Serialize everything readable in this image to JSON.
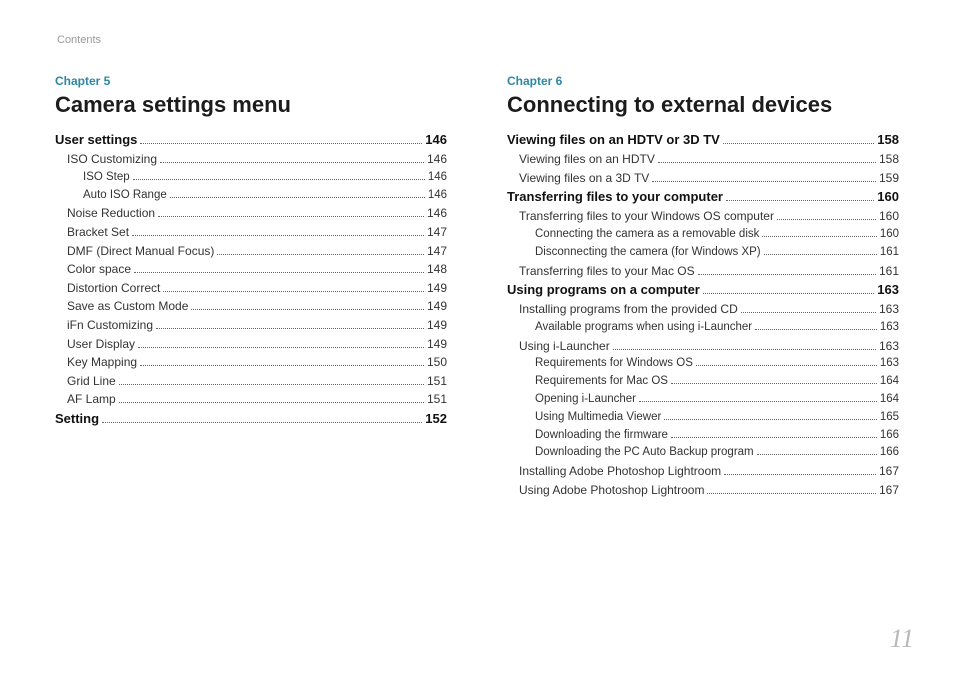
{
  "page_header": "Contents",
  "page_number": "11",
  "chapters": [
    {
      "label": "Chapter 5",
      "title": "Camera settings menu",
      "entries": [
        {
          "text": "User settings",
          "page": "146",
          "level": 0
        },
        {
          "text": "ISO Customizing",
          "page": "146",
          "level": 1
        },
        {
          "text": "ISO Step",
          "page": "146",
          "level": 2
        },
        {
          "text": "Auto ISO Range",
          "page": "146",
          "level": 2
        },
        {
          "text": "Noise Reduction",
          "page": "146",
          "level": 1
        },
        {
          "text": "Bracket Set",
          "page": "147",
          "level": 1
        },
        {
          "text": "DMF (Direct Manual Focus)",
          "page": "147",
          "level": 1
        },
        {
          "text": "Color space",
          "page": "148",
          "level": 1
        },
        {
          "text": "Distortion Correct",
          "page": "149",
          "level": 1
        },
        {
          "text": "Save as Custom Mode",
          "page": "149",
          "level": 1
        },
        {
          "text": "iFn Customizing",
          "page": "149",
          "level": 1
        },
        {
          "text": "User Display",
          "page": "149",
          "level": 1
        },
        {
          "text": "Key Mapping",
          "page": "150",
          "level": 1
        },
        {
          "text": "Grid Line",
          "page": "151",
          "level": 1
        },
        {
          "text": "AF Lamp",
          "page": "151",
          "level": 1
        },
        {
          "text": "Setting",
          "page": "152",
          "level": 0
        }
      ]
    },
    {
      "label": "Chapter 6",
      "title": "Connecting to external devices",
      "entries": [
        {
          "text": "Viewing files on an HDTV or 3D TV",
          "page": "158",
          "level": 0
        },
        {
          "text": "Viewing files on an HDTV",
          "page": "158",
          "level": 1
        },
        {
          "text": "Viewing files on a 3D TV",
          "page": "159",
          "level": 1
        },
        {
          "text": "Transferring files to your computer",
          "page": "160",
          "level": 0
        },
        {
          "text": "Transferring files to your Windows OS computer",
          "page": "160",
          "level": 1
        },
        {
          "text": "Connecting the camera as a removable disk",
          "page": "160",
          "level": 2
        },
        {
          "text": "Disconnecting the camera (for Windows XP)",
          "page": "161",
          "level": 2
        },
        {
          "text": "Transferring files to your Mac OS",
          "page": "161",
          "level": 1
        },
        {
          "text": "Using programs on a computer",
          "page": "163",
          "level": 0
        },
        {
          "text": "Installing programs from the provided CD",
          "page": "163",
          "level": 1
        },
        {
          "text": "Available programs when using i-Launcher",
          "page": "163",
          "level": 2
        },
        {
          "text": "Using i-Launcher",
          "page": "163",
          "level": 1
        },
        {
          "text": "Requirements for Windows OS",
          "page": "163",
          "level": 2
        },
        {
          "text": "Requirements for Mac OS",
          "page": "164",
          "level": 2
        },
        {
          "text": "Opening i-Launcher",
          "page": "164",
          "level": 2
        },
        {
          "text": "Using Multimedia Viewer",
          "page": "165",
          "level": 2
        },
        {
          "text": "Downloading the firmware",
          "page": "166",
          "level": 2
        },
        {
          "text": "Downloading the PC Auto Backup program",
          "page": "166",
          "level": 2
        },
        {
          "text": "Installing Adobe Photoshop Lightroom",
          "page": "167",
          "level": 1
        },
        {
          "text": "Using Adobe Photoshop Lightroom",
          "page": "167",
          "level": 1
        }
      ]
    }
  ]
}
